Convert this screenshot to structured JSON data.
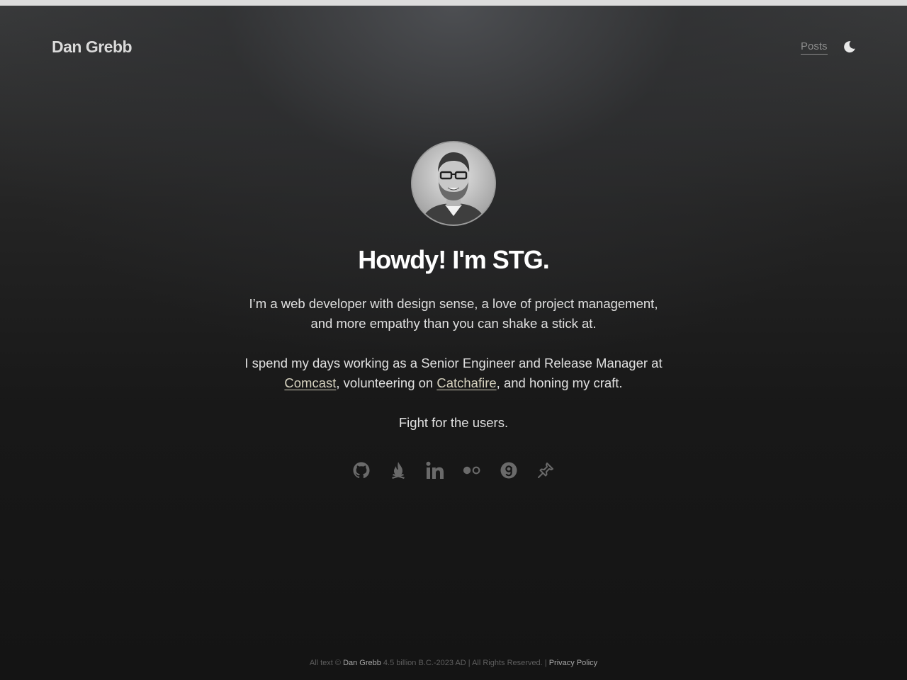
{
  "header": {
    "site_title": "Dan Grebb",
    "nav": [
      {
        "label": "Posts"
      }
    ],
    "theme_toggle_icon": "moon-icon"
  },
  "hero": {
    "avatar_icon": "avatar",
    "heading": "Howdy! I'm STG.",
    "p1": "I’m a web developer with design sense, a love of project management, and more empathy than you can shake a stick at.",
    "p2_prefix": "I spend my days working as a Senior Engineer and Release Manager at ",
    "p2_link1": "Comcast",
    "p2_mid": ", volunteering on ",
    "p2_link2": "Catchafire",
    "p2_suffix": ", and honing my craft.",
    "p3": "Fight for the users."
  },
  "social": [
    {
      "icon": "github-icon"
    },
    {
      "icon": "campfire-icon"
    },
    {
      "icon": "linkedin-icon"
    },
    {
      "icon": "flickr-icon"
    },
    {
      "icon": "goodreads-icon"
    },
    {
      "icon": "pin-icon"
    }
  ],
  "footer": {
    "prefix": "All text © ",
    "author": "Dan Grebb",
    "middle": " 4.5 billion B.C.-2023 AD | All Rights Reserved. | ",
    "privacy": "Privacy Policy"
  },
  "colors": {
    "background": "#141414",
    "heading": "#ffffff",
    "text": "#e0e0e0",
    "link": "#d6d2bf",
    "icon": "#6a6a6a"
  }
}
